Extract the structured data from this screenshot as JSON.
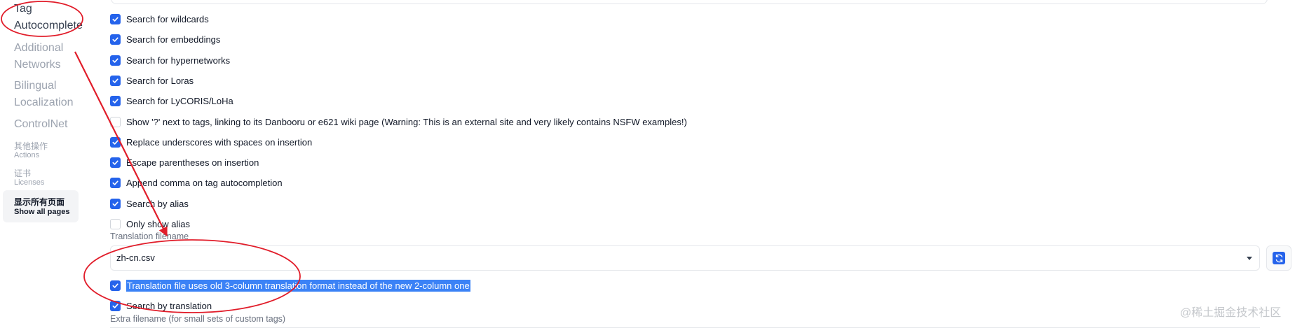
{
  "sidebar": {
    "items": [
      {
        "label_line1": "Tag",
        "label_line2": "Autocomplete"
      },
      {
        "label_line1": "Additional",
        "label_line2": "Networks"
      },
      {
        "label_line1": "Bilingual",
        "label_line2": "Localization"
      },
      {
        "label_line1": "ControlNet"
      }
    ],
    "actions": {
      "cn": "其他操作",
      "en": "Actions"
    },
    "licenses": {
      "cn": "证书",
      "en": "Licenses"
    },
    "show_all": {
      "cn": "显示所有页面",
      "en": "Show all pages"
    }
  },
  "options": [
    {
      "label": "Search for wildcards",
      "checked": true
    },
    {
      "label": "Search for embeddings",
      "checked": true
    },
    {
      "label": "Search for hypernetworks",
      "checked": true
    },
    {
      "label": "Search for Loras",
      "checked": true
    },
    {
      "label": "Search for LyCORIS/LoHa",
      "checked": true
    },
    {
      "label": "Show '?' next to tags, linking to its Danbooru or e621 wiki page (Warning: This is an external site and very likely contains NSFW examples!)",
      "checked": false
    },
    {
      "label": "Replace underscores with spaces on insertion",
      "checked": true
    },
    {
      "label": "Escape parentheses on insertion",
      "checked": true
    },
    {
      "label": "Append comma on tag autocompletion",
      "checked": true
    },
    {
      "label": "Search by alias",
      "checked": true
    },
    {
      "label": "Only show alias",
      "checked": false
    }
  ],
  "translation": {
    "label": "Translation filename",
    "value": "zh-cn.csv",
    "old_format": {
      "label": "Translation file uses old 3-column translation format instead of the new 2-column one",
      "checked": true
    },
    "search_by_translation": {
      "label": "Search by translation",
      "checked": true
    }
  },
  "extra": {
    "label": "Extra filename (for small sets of custom tags)"
  },
  "watermark": "@稀土掘金技术社区",
  "colors": {
    "accent": "#2563eb",
    "annotation": "#e11d2a"
  },
  "icons": {
    "check": "check-icon",
    "caret": "chevron-down-icon",
    "refresh": "refresh-icon"
  }
}
